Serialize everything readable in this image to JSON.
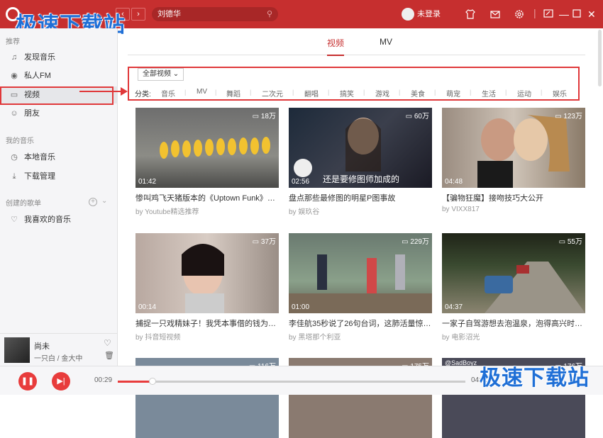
{
  "search": {
    "value": "刘德华"
  },
  "watermark": "极速下载站",
  "user": {
    "login_label": "未登录"
  },
  "sidebar": {
    "recommend_title": "推荐",
    "items": [
      {
        "label": "发现音乐",
        "icon": "music-note-icon"
      },
      {
        "label": "私人FM",
        "icon": "radio-icon"
      },
      {
        "label": "视频",
        "icon": "video-icon"
      },
      {
        "label": "朋友",
        "icon": "friends-icon"
      }
    ],
    "my_music_title": "我的音乐",
    "my_items": [
      {
        "label": "本地音乐",
        "icon": "local-music-icon"
      },
      {
        "label": "下载管理",
        "icon": "download-icon"
      }
    ],
    "playlist_title": "创建的歌单",
    "playlists": [
      {
        "label": "我喜欢的音乐",
        "icon": "heart-icon"
      }
    ]
  },
  "tabs": [
    {
      "label": "视频"
    },
    {
      "label": "MV"
    }
  ],
  "filter": {
    "all_label": "全部视频",
    "cat_label": "分类:",
    "categories": [
      "音乐",
      "MV",
      "舞蹈",
      "二次元",
      "翻唱",
      "搞笑",
      "游戏",
      "美食",
      "萌宠",
      "生活",
      "运动",
      "娱乐"
    ]
  },
  "videos": [
    {
      "count": "18万",
      "duration": "01:42",
      "title": "惨叫鸡飞天猪版本的《Uptown Funk》你一…",
      "by": "by Youtube精选推荐"
    },
    {
      "count": "60万",
      "duration": "02:56",
      "title": "盘点那些最修图的明星P图事故",
      "by": "by 娱玖谷",
      "overlay": "还是要修图师加成的"
    },
    {
      "count": "123万",
      "duration": "04:48",
      "title": "【骗物狂魔】接吻技巧大公开",
      "by": "by VIXX817"
    },
    {
      "count": "37万",
      "duration": "00:14",
      "title": "捕捉一只戏精妹子！我凭本事借的钱为什么…",
      "by": "by 抖音短视频"
    },
    {
      "count": "229万",
      "duration": "01:00",
      "title": "李佳航35秒说了26句台词，这肺活量惊呆…",
      "by": "by 黑塔那个利亚"
    },
    {
      "count": "55万",
      "duration": "04:37",
      "title": "一家子自驾游想去泡温泉，泡得高兴时发生…",
      "by": "by 电影沼光"
    },
    {
      "count": "116万"
    },
    {
      "count": "175万"
    },
    {
      "count": "176万",
      "overlay": "@SadBoyz"
    }
  ],
  "player": {
    "song": "尚未",
    "artist": "一只白 / 金大中",
    "current_time": "00:29",
    "total_time": "04:40",
    "progress": 0.1
  }
}
